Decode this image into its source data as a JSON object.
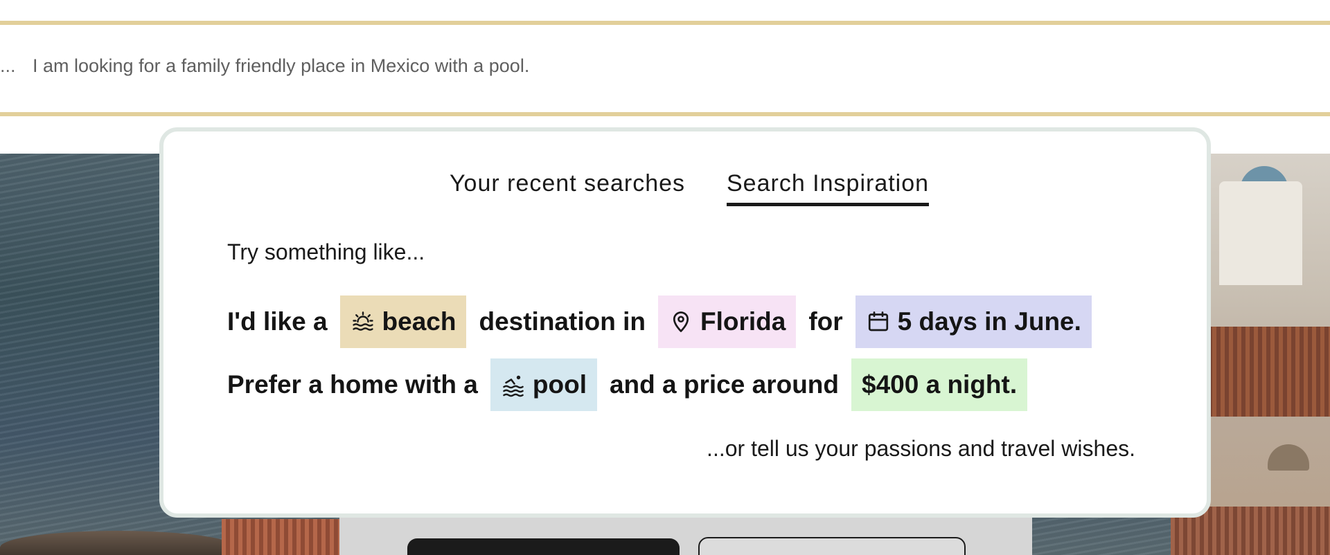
{
  "search": {
    "leading": "...",
    "query": "I am looking for a family friendly place in Mexico with a pool."
  },
  "dropdown": {
    "tabs": [
      {
        "label": "Your recent searches",
        "active": false
      },
      {
        "label": "Search Inspiration",
        "active": true
      }
    ],
    "intro": "Try something like...",
    "sentence1": {
      "part1": "I'd like a",
      "chip1": {
        "label": "beach",
        "icon": "sunrise-waves-icon",
        "color": "#ebdcb7"
      },
      "part2": "destination in",
      "chip2": {
        "label": "Florida",
        "icon": "map-pin-icon",
        "color": "#f7e3f5"
      },
      "part3": "for",
      "chip3": {
        "label": "5 days in June.",
        "icon": "calendar-icon",
        "color": "#d6d7f3"
      }
    },
    "sentence2": {
      "part1": "Prefer a home with a",
      "chip1": {
        "label": "pool",
        "icon": "swimmer-icon",
        "color": "#d5e8f0"
      },
      "part2": "and a price around",
      "chip2": {
        "label": "$400 a night.",
        "color": "#d8f5d2"
      }
    },
    "outro": "...or tell us your passions and travel wishes."
  },
  "colors": {
    "search_border": "#e2cf9a",
    "panel_border": "#dfe7e3"
  }
}
